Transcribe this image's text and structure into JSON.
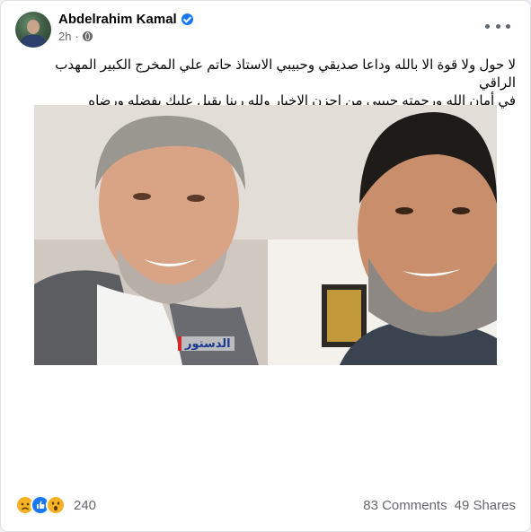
{
  "post": {
    "author": {
      "name": "Abdelrahim Kamal",
      "verified": true
    },
    "time": "2h",
    "audience_icon": "globe-icon",
    "menu_icon": "more-horizontal-icon",
    "text_line1": "لا حول ولا قوة الا بالله وداعا صديقي وحبيبي الاستاذ حاتم علي المخرج الكبير المهدب الراقي",
    "text_line2": "في أمان الله ورحمته حبيبي من احزن الاخبار ولله ربنا يقبل عليك بفضله ورضاه",
    "photo": {
      "watermark": "الدستور"
    }
  },
  "engagement": {
    "reactions": [
      "sad-reaction-icon",
      "like-reaction-icon",
      "wow-reaction-icon"
    ],
    "reaction_count": "240",
    "comments": "83 Comments",
    "shares": "49 Shares"
  },
  "colors": {
    "accent": "#1877f2",
    "secondary_text": "#65676b",
    "card_bg": "#ffffff",
    "page_bg": "#f0f2f5"
  }
}
